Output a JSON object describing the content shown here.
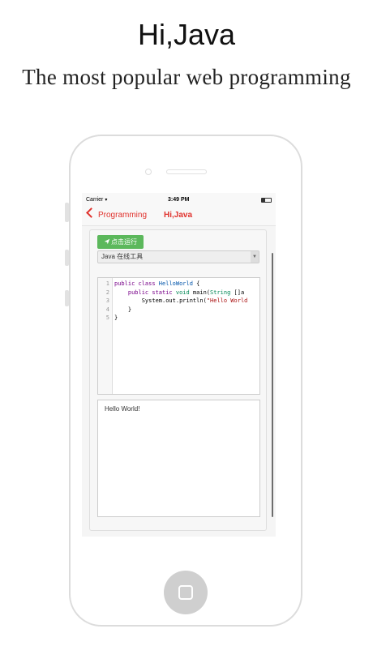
{
  "header": {
    "title": "Hi,Java",
    "subtitle": "The most popular web programming"
  },
  "status_bar": {
    "carrier": "Carrier",
    "time": "3:49 PM"
  },
  "nav": {
    "back_label": "Programming",
    "title": "Hi,Java"
  },
  "toolbar": {
    "run_label": "点击运行",
    "run_icon": "send-icon",
    "language_select": "Java 在线工具"
  },
  "editor": {
    "line_numbers": [
      "1",
      "2",
      "3",
      "4",
      "5"
    ],
    "lines": [
      [
        {
          "t": "public class ",
          "c": "kw"
        },
        {
          "t": "HelloWorld",
          "c": "ty"
        },
        {
          "t": " {",
          "c": ""
        }
      ],
      [
        {
          "t": "    public static ",
          "c": "kw"
        },
        {
          "t": "void",
          "c": "tp"
        },
        {
          "t": " main(",
          "c": ""
        },
        {
          "t": "String",
          "c": "tp"
        },
        {
          "t": " []a",
          "c": ""
        }
      ],
      [
        {
          "t": "        System.out.println(",
          "c": ""
        },
        {
          "t": "\"Hello World",
          "c": "str"
        }
      ],
      [
        {
          "t": "    }",
          "c": ""
        }
      ],
      [
        {
          "t": "}",
          "c": ""
        }
      ]
    ]
  },
  "output": {
    "text": "Hello World!"
  },
  "colors": {
    "accent": "#e0322d",
    "run_button": "#5cb85c"
  }
}
